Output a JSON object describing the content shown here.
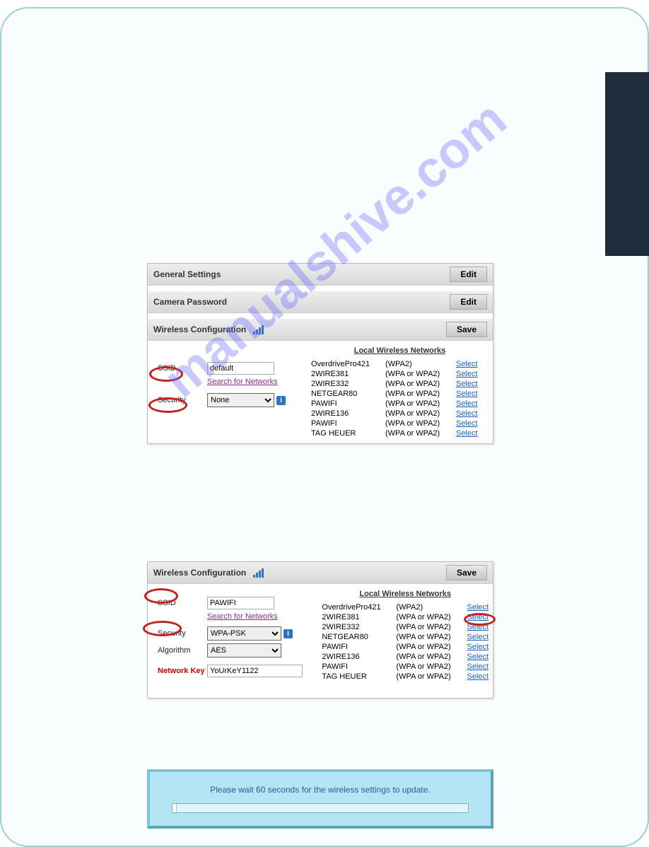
{
  "watermark": "manualshive.com",
  "panel1": {
    "sections": {
      "general": {
        "title": "General Settings",
        "button": "Edit"
      },
      "password": {
        "title": "Camera Password",
        "button": "Edit"
      },
      "wireless": {
        "title": "Wireless Configuration",
        "button": "Save"
      }
    },
    "labels": {
      "ssid": "SSID",
      "security": "Security"
    },
    "values": {
      "ssid": "default",
      "security": "None"
    },
    "search_link": "Search for Networks",
    "list_title": "Local Wireless Networks",
    "networks": [
      {
        "name": "OverdrivePro421",
        "sec": "(WPA2)"
      },
      {
        "name": "2WIRE381",
        "sec": "(WPA or WPA2)"
      },
      {
        "name": "2WIRE332",
        "sec": "(WPA or WPA2)"
      },
      {
        "name": "NETGEAR80",
        "sec": "(WPA or WPA2)"
      },
      {
        "name": "PAWIFI",
        "sec": "(WPA or WPA2)"
      },
      {
        "name": "2WIRE136",
        "sec": "(WPA or WPA2)"
      },
      {
        "name": "PAWIFI",
        "sec": "(WPA or WPA2)"
      },
      {
        "name": "TAG HEUER",
        "sec": "(WPA or WPA2)"
      }
    ],
    "select_label": "Select"
  },
  "panel2": {
    "wireless": {
      "title": "Wireless Configuration",
      "button": "Save"
    },
    "labels": {
      "ssid": "SSID",
      "security": "Security",
      "algorithm": "Algorithm",
      "network_key": "Network Key"
    },
    "values": {
      "ssid": "PAWIFI",
      "security": "WPA-PSK",
      "algorithm": "AES",
      "network_key": "YoUrKeY1122"
    },
    "search_link": "Search for Networks",
    "list_title": "Local Wireless Networks",
    "networks": [
      {
        "name": "OverdrivePro421",
        "sec": "(WPA2)"
      },
      {
        "name": "2WIRE381",
        "sec": "(WPA or WPA2)"
      },
      {
        "name": "2WIRE332",
        "sec": "(WPA or WPA2)"
      },
      {
        "name": "NETGEAR80",
        "sec": "(WPA or WPA2)"
      },
      {
        "name": "PAWIFI",
        "sec": "(WPA or WPA2)"
      },
      {
        "name": "2WIRE136",
        "sec": "(WPA or WPA2)"
      },
      {
        "name": "PAWIFI",
        "sec": "(WPA or WPA2)"
      },
      {
        "name": "TAG HEUER",
        "sec": "(WPA or WPA2)"
      }
    ],
    "select_label": "Select"
  },
  "wait": {
    "message": "Please wait 60 seconds for the wireless settings to update."
  }
}
